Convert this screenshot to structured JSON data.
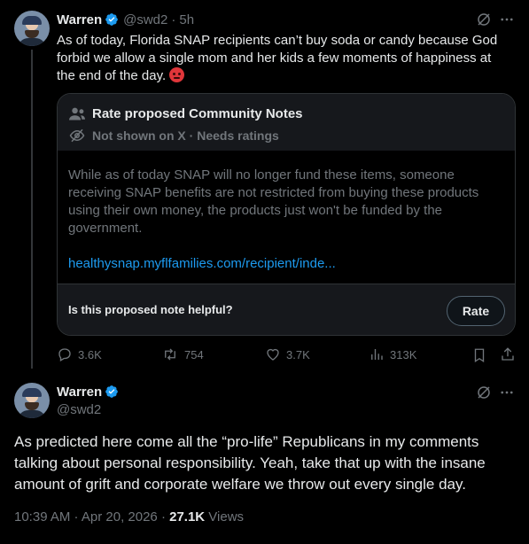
{
  "tweet1": {
    "author_name": "Warren",
    "handle": "@swd2",
    "sep": "·",
    "time": "5h",
    "text": "As of today, Florida SNAP recipients can’t buy soda or candy because God forbid we allow a single mom and her kids a few moments of happiness at the end of the day.",
    "emoji": "angry-face",
    "community_note": {
      "title": "Rate proposed Community Notes",
      "status": "Not shown on X · Needs ratings",
      "body": "While as of today SNAP will no longer fund these items, someone receiving SNAP benefits are not restricted from buying these products using their own money, the products just won't be funded by the government.",
      "link": "healthysnap.myflfamilies.com/recipient/inde...",
      "question": "Is this proposed note helpful?",
      "rate_label": "Rate"
    },
    "metrics": {
      "replies": "3.6K",
      "reposts": "754",
      "likes": "3.7K",
      "views": "313K"
    }
  },
  "tweet2": {
    "author_name": "Warren",
    "handle": "@swd2",
    "text": "As predicted here come all the “pro-life” Republicans in my comments talking about personal responsibility. Yeah, take that up with the insane amount of grift and corporate welfare we throw out every single day.",
    "timestamp": "10:39 AM · Apr 20, 2026 · ",
    "views_count": "27.1K",
    "views_label": " Views"
  },
  "icons": {
    "verified": "verified-badge-icon",
    "grok": "grok-icon",
    "more": "more-icon",
    "people": "people-icon",
    "eye_off": "eye-off-icon",
    "reply": "reply-icon",
    "repost": "repost-icon",
    "like": "like-icon",
    "views": "views-icon",
    "bookmark": "bookmark-icon",
    "share": "share-icon"
  },
  "colors": {
    "background": "#000000",
    "text": "#e7e9ea",
    "muted": "#71767b",
    "link": "#1d9bf0",
    "verified": "#1d9bf0",
    "card_header": "#16181c",
    "border": "#2f3336"
  }
}
